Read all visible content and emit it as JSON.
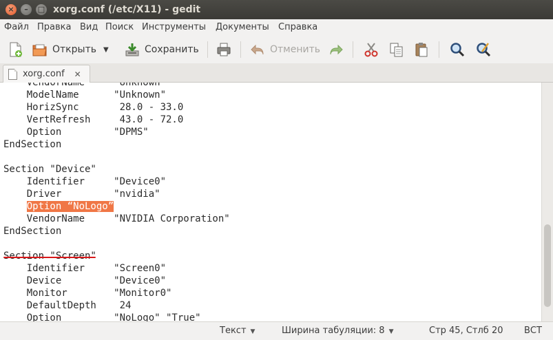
{
  "window": {
    "title": "xorg.conf (/etc/X11) - gedit"
  },
  "menu": [
    "Файл",
    "Правка",
    "Вид",
    "Поиск",
    "Инструменты",
    "Документы",
    "Справка"
  ],
  "toolbar": {
    "open_label": "Открыть",
    "save_label": "Сохранить",
    "undo_label": "Отменить"
  },
  "tab": {
    "name": "xorg.conf"
  },
  "editor": {
    "lines": [
      "    VendorName     \"Unknown\"",
      "    ModelName      \"Unknown\"",
      "    HorizSync       28.0 - 33.0",
      "    VertRefresh     43.0 - 72.0",
      "    Option         \"DPMS\"",
      "EndSection",
      "",
      "Section \"Device\"",
      "    Identifier     \"Device0\"",
      "    Driver         \"nvidia\"",
      "    Option “NoLogo”",
      "    VendorName     \"NVIDIA Corporation\"",
      "EndSection",
      "",
      "Section \"Screen\"",
      "    Identifier     \"Screen0\"",
      "    Device         \"Device0\"",
      "    Monitor        \"Monitor0\"",
      "    DefaultDepth    24",
      "    Option         \"NoLogo\" \"True\""
    ],
    "highlight": {
      "line": 10,
      "indent": "    ",
      "text": "Option “NoLogo”"
    },
    "highlight_color": "#f07746",
    "underline_color": "#d8181a"
  },
  "status": {
    "syntax": "Текст",
    "tab_width": "Ширина табуляции: 8",
    "position": "Стр 45, Стлб 20",
    "mode": "ВСТ"
  }
}
